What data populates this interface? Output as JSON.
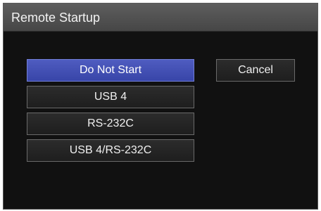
{
  "dialog": {
    "title": "Remote Startup"
  },
  "options": [
    {
      "label": "Do Not Start",
      "selected": true
    },
    {
      "label": "USB 4",
      "selected": false
    },
    {
      "label": "RS-232C",
      "selected": false
    },
    {
      "label": "USB 4/RS-232C",
      "selected": false
    }
  ],
  "buttons": {
    "cancel_label": "Cancel"
  },
  "colors": {
    "selected": "#3f4cb4",
    "background": "#111111",
    "title_bar": "#4f4f4f"
  }
}
